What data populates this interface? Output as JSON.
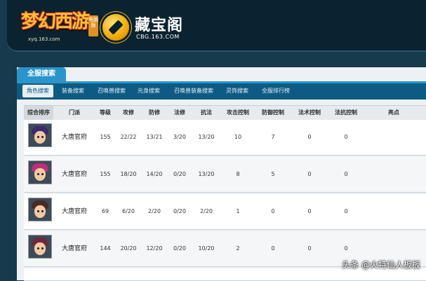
{
  "header": {
    "game_logo_text": "梦幻西游",
    "game_logo_tag": "电脑版",
    "game_logo_url": "xyq.163.com",
    "cbg_title": "藏宝阁",
    "cbg_url": "CBG.163.COM"
  },
  "panel": {
    "tab_label": "全服搜索",
    "nav": [
      {
        "label": "角色搜索",
        "active": true
      },
      {
        "label": "装备搜索",
        "active": false
      },
      {
        "label": "召唤兽搜索",
        "active": false
      },
      {
        "label": "元身搜索",
        "active": false
      },
      {
        "label": "召唤兽装备搜索",
        "active": false
      },
      {
        "label": "灵饰搜索",
        "active": false
      },
      {
        "label": "全服排行榜",
        "active": false
      }
    ]
  },
  "table": {
    "columns": [
      "综合排序",
      "门派",
      "等级",
      "攻修",
      "防修",
      "法修",
      "抗法",
      "攻击控制",
      "防御控制",
      "法术控制",
      "法抗控制",
      "亮点"
    ],
    "rows": [
      {
        "faction": "大唐官府",
        "level": "155",
        "atk": "22/22",
        "def": "13/21",
        "mag": "3/20",
        "res": "13/20",
        "c_atk": "10",
        "c_def": "7",
        "c_mag": "0",
        "c_res": "0",
        "hair": "#3b2a6e"
      },
      {
        "faction": "大唐官府",
        "level": "155",
        "atk": "18/20",
        "def": "14/20",
        "mag": "0/20",
        "res": "13/20",
        "c_atk": "8",
        "c_def": "5",
        "c_mag": "0",
        "c_res": "0",
        "hair": "#c02c7a"
      },
      {
        "faction": "大唐官府",
        "level": "69",
        "atk": "6/20",
        "def": "2/20",
        "mag": "0/20",
        "res": "2/20",
        "c_atk": "1",
        "c_def": "0",
        "c_mag": "0",
        "c_res": "0",
        "hair": "#4a2b1f"
      },
      {
        "faction": "大唐官府",
        "level": "144",
        "atk": "20/20",
        "def": "12/20",
        "mag": "0/20",
        "res": "10/20",
        "c_atk": "2",
        "c_def": "0",
        "c_mag": "0",
        "c_res": "0",
        "hair": "#6b2a3c"
      }
    ]
  },
  "watermark": "头条 @火特仙人板板"
}
